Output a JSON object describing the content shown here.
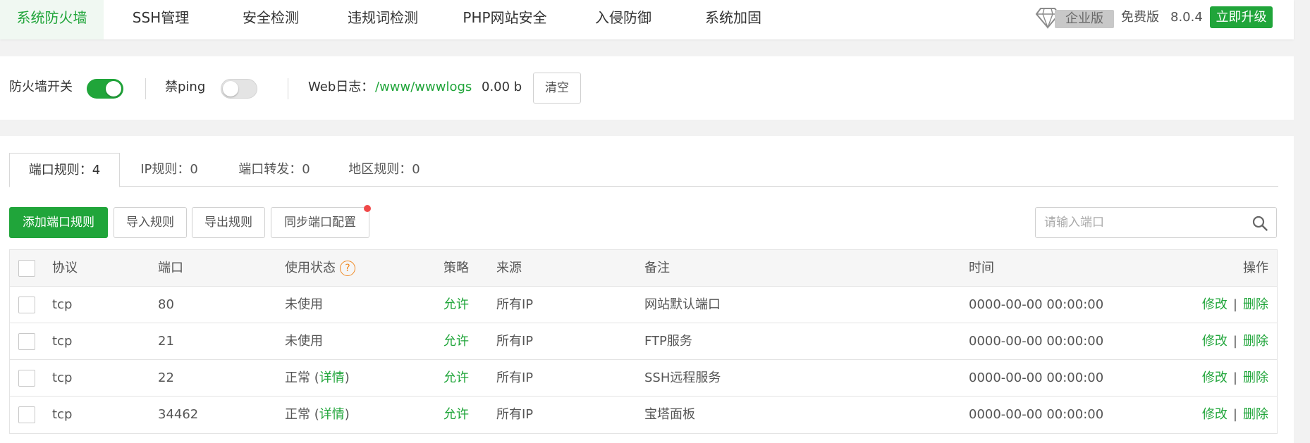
{
  "nav": {
    "tabs": [
      "系统防火墙",
      "SSH管理",
      "安全检测",
      "违规词检测",
      "PHP网站安全",
      "入侵防御",
      "系统加固"
    ],
    "enterprise_label": "企业版",
    "free_label": "免费版",
    "version": "8.0.4",
    "upgrade_label": "立即升级"
  },
  "switchbar": {
    "firewall_label": "防火墙开关",
    "firewall_on": true,
    "ping_label": "禁ping",
    "ping_on": false,
    "weblog_label": "Web日志：",
    "weblog_path": "/www/wwwlogs",
    "weblog_size": "0.00 b",
    "clear_label": "清空"
  },
  "rule_tabs": [
    "端口规则：4",
    "IP规则：0",
    "端口转发：0",
    "地区规则：0"
  ],
  "toolbar": {
    "add_label": "添加端口规则",
    "import_label": "导入规则",
    "export_label": "导出规则",
    "sync_label": "同步端口配置",
    "search_placeholder": "请输入端口"
  },
  "table": {
    "headers": {
      "protocol": "协议",
      "port": "端口",
      "status": "使用状态",
      "help": "?",
      "policy": "策略",
      "source": "来源",
      "remark": "备注",
      "time": "时间",
      "ops": "操作"
    },
    "rows": [
      {
        "protocol": "tcp",
        "port": "80",
        "status": "未使用",
        "detail": "",
        "policy": "允许",
        "source": "所有IP",
        "remark": "网站默认端口",
        "time": "0000-00-00 00:00:00"
      },
      {
        "protocol": "tcp",
        "port": "21",
        "status": "未使用",
        "detail": "",
        "policy": "允许",
        "source": "所有IP",
        "remark": "FTP服务",
        "time": "0000-00-00 00:00:00"
      },
      {
        "protocol": "tcp",
        "port": "22",
        "status": "正常 (",
        "detail": "详情",
        "policy": "允许",
        "source": "所有IP",
        "remark": "SSH远程服务",
        "time": "0000-00-00 00:00:00"
      },
      {
        "protocol": "tcp",
        "port": "34462",
        "status": "正常 (",
        "detail": "详情",
        "policy": "允许",
        "source": "所有IP",
        "remark": "宝塔面板",
        "time": "0000-00-00 00:00:00"
      }
    ],
    "edit_label": "修改",
    "sep": "|",
    "delete_label": "删除",
    "detail_close": ")"
  },
  "colors": {
    "accent": "#20a53a",
    "badge_dot": "#f04848",
    "help_icon": "#f08a24"
  }
}
